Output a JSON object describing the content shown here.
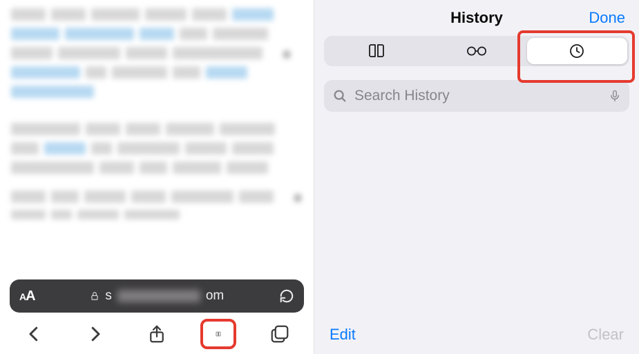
{
  "right": {
    "title": "History",
    "done": "Done",
    "tabs": {
      "bookmarks_icon": "book-icon",
      "readinglist_icon": "glasses-icon",
      "history_icon": "clock-icon",
      "active_index": 2
    },
    "search": {
      "placeholder": "Search History"
    },
    "footer": {
      "edit": "Edit",
      "clear": "Clear"
    }
  },
  "left": {
    "url_prefix": "s",
    "url_suffix": "om",
    "aa_label": "AA"
  }
}
